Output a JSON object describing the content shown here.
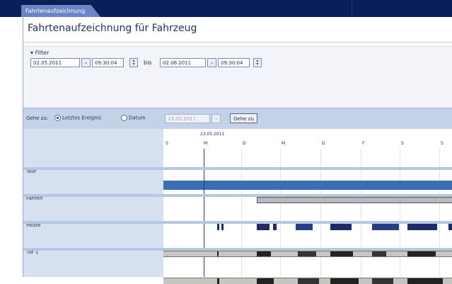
{
  "tab": {
    "label": "Fahrtenaufzeichnung"
  },
  "window": {
    "title": "Fahrtenaufzeichnung für Fahrzeug"
  },
  "filter": {
    "header": "Filter",
    "from_date": "02.05.2011",
    "from_time": "09:30:04",
    "to_label": "bis",
    "to_date": "02.06.2011",
    "to_time": "09:30:04"
  },
  "navigation": {
    "goto_label": "Gehe zu:",
    "option_last_event": "Letztes Ereignis",
    "option_date": "Datum",
    "date_value": "23.05.2011",
    "goto_button": "Gehe zu"
  },
  "timeline": {
    "date_header": "23.05.2011",
    "days": [
      "S",
      "M",
      "D",
      "M",
      "D",
      "F",
      "S",
      "S"
    ],
    "rows": [
      {
        "label": "Tour"
      },
      {
        "label": "Fahren"
      },
      {
        "label": "Pause"
      },
      {
        "label": "Tür 1"
      }
    ]
  },
  "colors": {
    "header_bar": "#0a1f57",
    "tab": "#6a86c6",
    "timeline_band": "#3b6fb4",
    "drive_segment": "#1e2a66",
    "tour_segment": "#b8b8bc"
  }
}
